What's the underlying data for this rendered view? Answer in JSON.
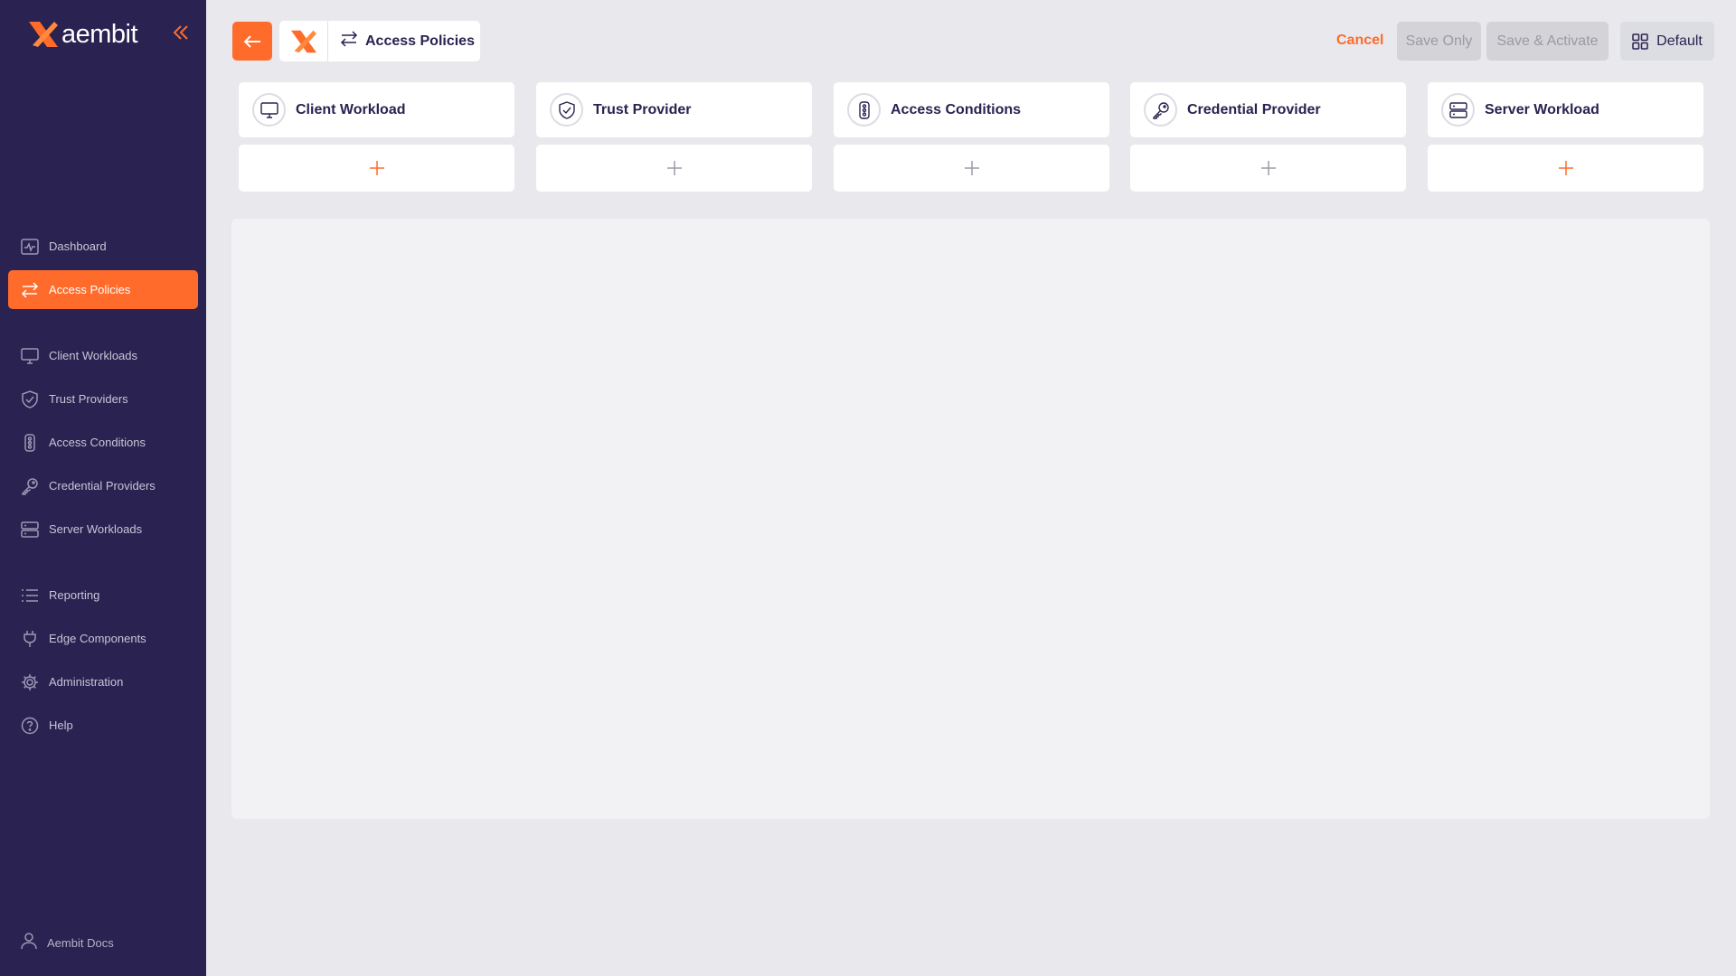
{
  "brand": {
    "name": "aembit",
    "accent": "#ff6b2b",
    "sidebar_bg": "#2a2250"
  },
  "sidebar": {
    "items": [
      {
        "label": "Dashboard",
        "icon": "dashboard-icon"
      },
      {
        "label": "Access Policies",
        "icon": "arrows-swap-icon",
        "active": true
      },
      {
        "label": "Client Workloads",
        "icon": "monitor-icon"
      },
      {
        "label": "Trust Providers",
        "icon": "shield-check-icon"
      },
      {
        "label": "Access Conditions",
        "icon": "traffic-light-icon"
      },
      {
        "label": "Credential Providers",
        "icon": "key-icon"
      },
      {
        "label": "Server Workloads",
        "icon": "server-icon"
      },
      {
        "label": "Reporting",
        "icon": "list-icon"
      },
      {
        "label": "Edge Components",
        "icon": "plug-icon"
      },
      {
        "label": "Administration",
        "icon": "gear-icon"
      },
      {
        "label": "Help",
        "icon": "help-icon"
      }
    ],
    "footer": {
      "label": "Aembit Docs",
      "icon": "user-icon"
    }
  },
  "header": {
    "title": "Access Policies",
    "cancel": "Cancel",
    "save_only": "Save Only",
    "save_activate": "Save & Activate",
    "layout": "Default"
  },
  "columns": [
    {
      "label": "Client Workload",
      "icon": "monitor-icon"
    },
    {
      "label": "Trust Provider",
      "icon": "shield-check-icon"
    },
    {
      "label": "Access Conditions",
      "icon": "traffic-light-icon"
    },
    {
      "label": "Credential Provider",
      "icon": "key-icon"
    },
    {
      "label": "Server Workload",
      "icon": "server-icon"
    }
  ]
}
